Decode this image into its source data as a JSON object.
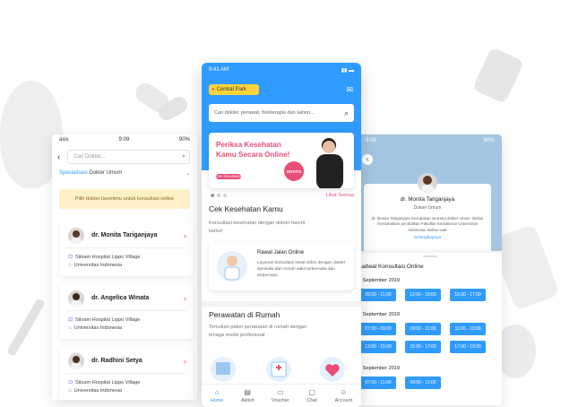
{
  "center_phone": {
    "status_time": "9:41 AM",
    "location": "Central Park",
    "search_placeholder": "Cari dokter, perawat, fisioterapis dan lainnn...",
    "promo": {
      "title": "Periksa Kesehatan Kamu Secara Online!",
      "pill": "CEK SEKARANG",
      "badge": "GRATIS"
    },
    "see_all": "Lihat Semua",
    "section1": {
      "title": "Cek Kesehatan Kamu",
      "subtitle": "Konsultasi kesehatan dengan dokter favorit kamu!"
    },
    "rawat_jalan": {
      "title": "Rawat Jalan Online",
      "desc": "Layanan konsultasi lewat video dengan dokter spesialis dari rumah sakit terkemuka dan terpercaya"
    },
    "section2": {
      "title": "Perawatan di Rumah",
      "subtitle": "Temukan paket perawatan di rumah dengan tenaga medis profesional"
    },
    "tabs": [
      {
        "label": "Home",
        "icon": "home-icon"
      },
      {
        "label": "Aktivit",
        "icon": "activity-icon"
      },
      {
        "label": "Voucher",
        "icon": "voucher-icon"
      },
      {
        "label": "Chat",
        "icon": "chat-icon"
      },
      {
        "label": "Account",
        "icon": "account-icon"
      }
    ],
    "colors": {
      "primary": "#2f9bff",
      "accent": "#e94e77",
      "location_bg": "#ffd43b"
    }
  },
  "left_phone": {
    "status_carrier": "axis",
    "status_time": "9:09",
    "status_battery": "90%",
    "search_placeholder": "Cari Dokter...",
    "spec_key": "Spesialisasi",
    "spec_value": "Dokter Umum",
    "banner": "Pilih dokter favoritmu untuk konsultasi online",
    "doctors": [
      {
        "name": "dr. Monita Tariganjaya",
        "hospital": "Siloam Hospital Lippo Village",
        "university": "Universitas Indonesia"
      },
      {
        "name": "dr. Angelica Winata",
        "hospital": "Siloam Hospital Lippo Village",
        "university": "Universitas Indonesia"
      },
      {
        "name": "dr. Radhini Setya",
        "hospital": "Siloam Hospital Lippo Village",
        "university": "Universitas Indonesia"
      }
    ]
  },
  "right_phone": {
    "status_time": "9:09",
    "status_battery": "90%",
    "doctor_name": "dr. Monita Tariganjaya",
    "doctor_role": "Dokter Umum",
    "bio": "dr. Monita Tariganjaya merupakan seorang dokter umum. Beliau menamatkan pendidikan Fakultas Kedokteran Universitas Indonesia. Beliau saat",
    "more": "Selengkapnya",
    "schedule_title": "Jadwal Konsultasi Online",
    "dates": [
      "1 September 2019",
      "2 September 2019",
      "3 September 2019"
    ],
    "slots": [
      [
        "09:00 - 11:00",
        "12:00 - 15:00",
        "16:00 - 17:00"
      ],
      [
        "07:00 - 09:00",
        "09:00 - 11:00",
        "11:00 - 13:00"
      ],
      [
        "13:00 - 15:00",
        "15:00 - 17:00",
        "17:00 - 19:00"
      ],
      [
        "07:00 - 11:00",
        "09:00 - 11:00"
      ]
    ]
  }
}
